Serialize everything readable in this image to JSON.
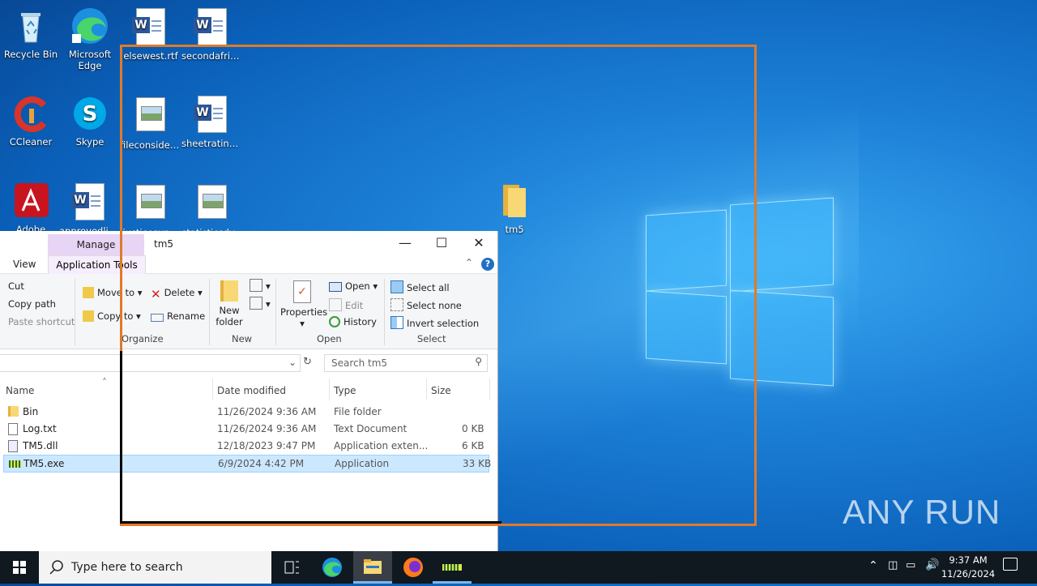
{
  "desktop": {
    "icons": [
      {
        "label": "Recycle Bin",
        "icon": "recycle-bin-icon"
      },
      {
        "label": "Microsoft Edge",
        "icon": "edge-icon"
      },
      {
        "label": "elsewest.rtf",
        "icon": "word-doc-icon"
      },
      {
        "label": "secondafric...",
        "icon": "word-doc-icon"
      },
      {
        "label": "CCleaner",
        "icon": "ccleaner-icon"
      },
      {
        "label": "Skype",
        "icon": "skype-icon"
      },
      {
        "label": "fileconsider...",
        "icon": "image-file-icon"
      },
      {
        "label": "sheetrating...",
        "icon": "word-doc-icon"
      },
      {
        "label": "Adobe",
        "icon": "adobe-icon"
      },
      {
        "label": "approvedliv...",
        "icon": "word-doc-icon"
      },
      {
        "label": "justicesun...",
        "icon": "image-file-icon"
      },
      {
        "label": "statisticsdv...",
        "icon": "image-file-icon"
      },
      {
        "label": "tm5",
        "icon": "folder-icon"
      }
    ]
  },
  "explorer": {
    "context_tab": "Manage",
    "title": "tm5",
    "tabs": {
      "view": "View",
      "app_tools": "Application Tools"
    },
    "ribbon": {
      "cut": "Cut",
      "copy_path": "Copy path",
      "paste_shortcut": "Paste shortcut",
      "move_to": "Move to",
      "copy_to": "Copy to",
      "delete": "Delete",
      "rename": "Rename",
      "organize": "Organize",
      "new_folder_1": "New",
      "new_folder_2": "folder",
      "new_group": "New",
      "properties": "Properties",
      "open": "Open",
      "edit": "Edit",
      "history": "History",
      "open_group": "Open",
      "select_all": "Select all",
      "select_none": "Select none",
      "invert_selection": "Invert selection",
      "select_group": "Select"
    },
    "search_placeholder": "Search tm5",
    "columns": {
      "name": "Name",
      "date": "Date modified",
      "type": "Type",
      "size": "Size"
    },
    "files": [
      {
        "name": "Bin",
        "date": "11/26/2024 9:36 AM",
        "type": "File folder",
        "size": ""
      },
      {
        "name": "Log.txt",
        "date": "11/26/2024 9:36 AM",
        "type": "Text Document",
        "size": "0 KB"
      },
      {
        "name": "TM5.dll",
        "date": "12/18/2023 9:47 PM",
        "type": "Application exten...",
        "size": "6 KB"
      },
      {
        "name": "TM5.exe",
        "date": "6/9/2024 4:42 PM",
        "type": "Application",
        "size": "33 KB"
      }
    ]
  },
  "taskbar": {
    "search_placeholder": "Type here to search",
    "time": "9:37 AM",
    "date": "11/26/2024"
  },
  "watermark": "ANY RUN",
  "colors": {
    "marker_orange": "#e07a2a",
    "selection": "#cce8ff",
    "context_tab": "#e8d4f5"
  }
}
